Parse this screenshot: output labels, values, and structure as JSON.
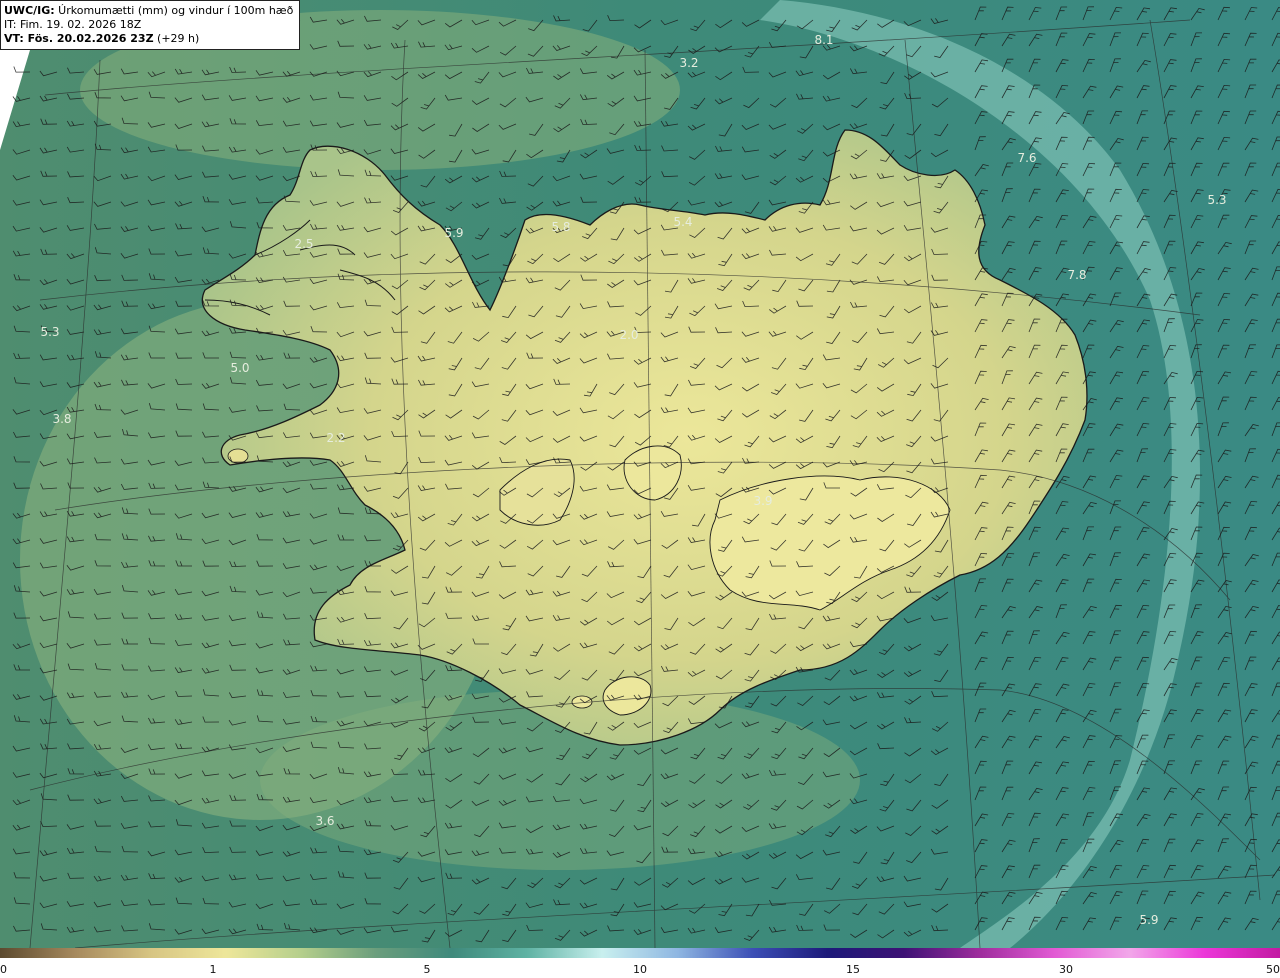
{
  "header": {
    "model": "UWC/IG:",
    "title": " Úrkomumætti (mm) og vindur í 100m hæð",
    "init_time": "IT: Fim. 19. 02. 2026 18Z",
    "valid_prefix": "VT: ",
    "valid_time": "Fös. 20.02.2026 23Z",
    "lead": " (+29 h)"
  },
  "value_labels": [
    "8.1",
    "3.2",
    "7.6",
    "5.3",
    "5.4",
    "5.8",
    "5.9",
    "2.5",
    "7.8",
    "5.3",
    "5.0",
    "3.8",
    "2.0",
    "2.2",
    "3.9",
    "3.6",
    "5.9"
  ],
  "colorbar": {
    "ticks": [
      "0",
      "1",
      "5",
      "10",
      "15",
      "30",
      "50"
    ],
    "colors": [
      "#5c4a2f",
      "#a78a5e",
      "#d7c583",
      "#eee79a",
      "#b5cf8c",
      "#6b9e7d",
      "#3f8a7c",
      "#5fb3a4",
      "#c9f0ef",
      "#8fb7e2",
      "#3c4fb6",
      "#1d1a7a",
      "#3d1275",
      "#9e2d9d",
      "#e25ad4",
      "#f2a7ea",
      "#ec38d9",
      "#c31aa3"
    ]
  },
  "colors": {
    "ocean": "#3f8a7c",
    "land_dry": "#e4df94",
    "coast": "#1a1a1a"
  }
}
